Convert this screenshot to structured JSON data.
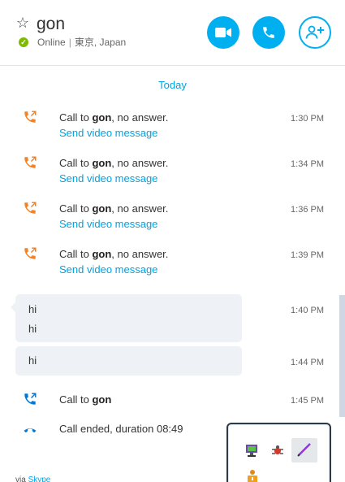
{
  "header": {
    "star_glyph": "☆",
    "contact_name": "gon",
    "presence_status": "Online",
    "separator": "|",
    "location": "東京, Japan",
    "presence_color": "#7fba00",
    "video_button_icon": "video-camera-icon",
    "call_button_icon": "phone-icon",
    "add_button_icon": "add-person-icon"
  },
  "accent_color": "#00aff0",
  "missed_call_color": "#f58220",
  "conversation": {
    "date_separator": "Today",
    "missed_calls": [
      {
        "prefix": "Call to ",
        "name": "gon",
        "suffix": ", no answer.",
        "action": "Send video message",
        "time": "1:30 PM"
      },
      {
        "prefix": "Call to ",
        "name": "gon",
        "suffix": ", no answer.",
        "action": "Send video message",
        "time": "1:34 PM"
      },
      {
        "prefix": "Call to ",
        "name": "gon",
        "suffix": ", no answer.",
        "action": "Send video message",
        "time": "1:36 PM"
      },
      {
        "prefix": "Call to ",
        "name": "gon",
        "suffix": ", no answer.",
        "action": "Send video message",
        "time": "1:39 PM"
      }
    ],
    "messages": [
      {
        "lines": [
          "hi",
          "hi"
        ],
        "time": "1:40 PM"
      },
      {
        "lines": [
          "hi"
        ],
        "time": "1:44 PM"
      }
    ],
    "call": {
      "prefix": "Call to ",
      "name": "gon",
      "time": "1:45 PM"
    },
    "call_ended": {
      "text": "Call ended, duration 08:49"
    }
  },
  "footer": {
    "via_prefix": "via ",
    "via_brand": "Skype"
  },
  "tray": {
    "icons": [
      "network-monitor-icon",
      "bug-tool-icon",
      "pen-icon",
      "warning-user-icon"
    ]
  }
}
